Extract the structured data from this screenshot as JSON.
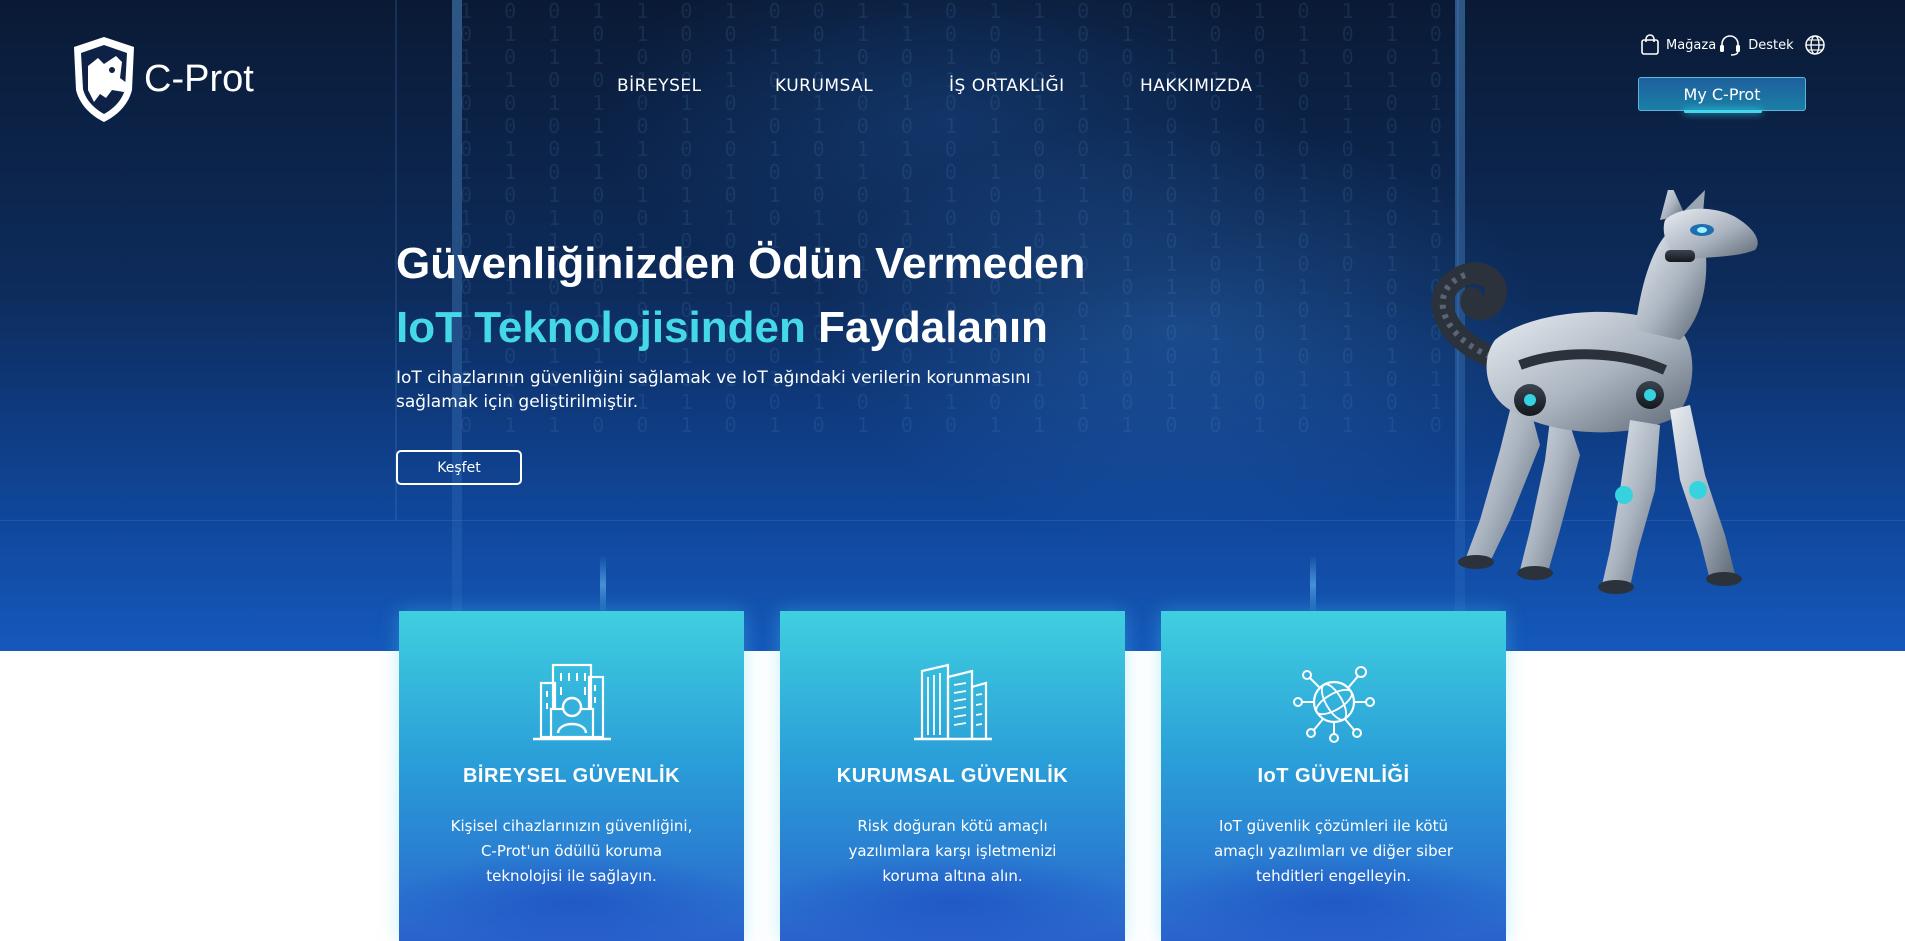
{
  "brand": {
    "name": "C-Prot"
  },
  "nav": {
    "items": [
      {
        "label": "BİREYSEL"
      },
      {
        "label": "KURUMSAL"
      },
      {
        "label": "İŞ ORTAKLIĞI"
      },
      {
        "label": "HAKKIMIZDA"
      }
    ]
  },
  "utility": {
    "store_label": "Mağaza",
    "support_label": "Destek",
    "my_account_label": "My C-Prot"
  },
  "hero": {
    "headline_line1": "Güvenliğinizden Ödün Vermeden",
    "headline_accent": "IoT Teknolojisinden",
    "headline_rest": "Faydalanın",
    "description": "IoT cihazlarının güvenliğini sağlamak ve IoT ağındaki verilerin korunmasını sağlamak için geliştirilmiştir.",
    "cta_label": "Keşfet"
  },
  "cards": [
    {
      "title": "BİREYSEL GÜVENLİK",
      "text": "Kişisel cihazlarınızın güvenliğini, C-Prot'un ödüllü koruma teknolojisi ile sağlayın.",
      "icon": "building-person-icon"
    },
    {
      "title": "KURUMSAL GÜVENLİK",
      "text": "Risk doğuran kötü amaçlı yazılımlara karşı işletmenizi koruma altına alın.",
      "icon": "office-buildings-icon"
    },
    {
      "title": "IoT GÜVENLİĞİ",
      "text": "IoT güvenlik çözümleri ile kötü amaçlı yazılımları ve diğer siber tehditleri engelleyin.",
      "icon": "network-globe-icon"
    }
  ],
  "colors": {
    "accent": "#45d8e6",
    "hero_dark": "#0a1a35",
    "hero_light": "#1559bb",
    "card_top": "#40cfe0",
    "card_bottom": "#2a62cc"
  }
}
